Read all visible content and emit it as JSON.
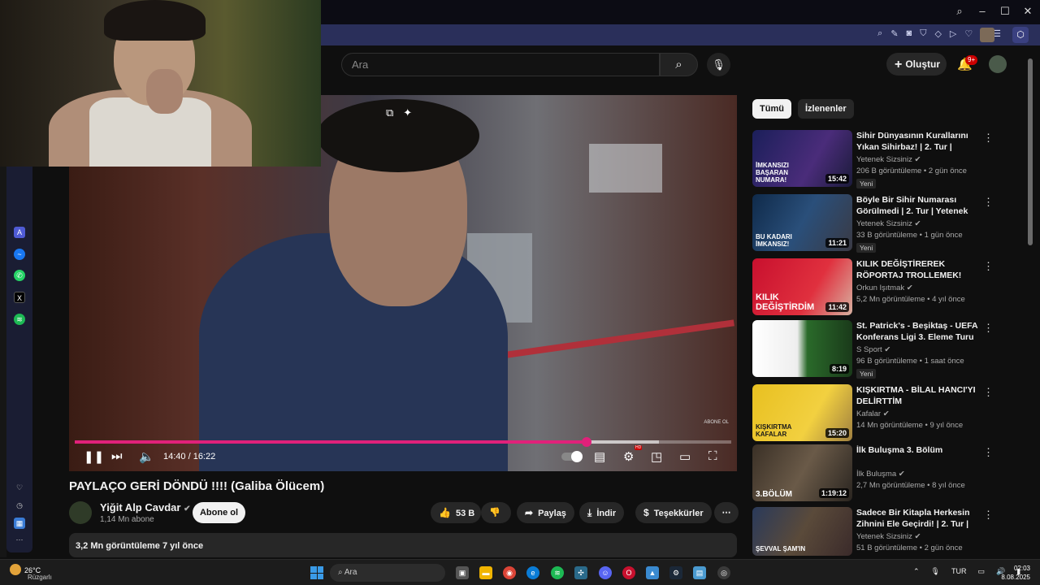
{
  "search": {
    "placeholder": "Ara"
  },
  "header": {
    "create_label": "Oluştur",
    "notification_badge": "9+"
  },
  "player": {
    "time": "14:40 / 16:22",
    "progress_fraction": 0.78,
    "buffer_fraction": 0.89,
    "watermark": "ABONE OL"
  },
  "video": {
    "title": "PAYLAÇO GERİ DÖNDÜ !!!! (Galiba Ölücem)",
    "channel": "Yiğit Alp Cavdar",
    "subscribers": "1,14 Mn abone",
    "subscribe_label": "Abone ol",
    "likes": "53 B",
    "share_label": "Paylaş",
    "download_label": "İndir",
    "thanks_label": "Teşekkürler",
    "description_meta": "3,2 Mn görüntüleme  7 yıl önce"
  },
  "chips": [
    "Tümü",
    "İzlenenler"
  ],
  "recommendations": [
    {
      "title": "Sihir Dünyasının Kurallarını Yıkan Sihirbaz! | 2. Tur | Yeten…",
      "channel": "Yetenek Sizsiniz",
      "meta": "206 B görüntüleme • 2 gün önce",
      "duration": "15:42",
      "badge": "Yeni",
      "thumb_text": "İMKANSIZI BAŞARAN NUMARA!"
    },
    {
      "title": "Böyle Bir Sihir Numarası Görülmedi | 2. Tur | Yetenek …",
      "channel": "Yetenek Sizsiniz",
      "meta": "33 B görüntüleme • 1 gün önce",
      "duration": "11:21",
      "badge": "Yeni",
      "thumb_text": "BU KADARI İMKANSIZ!"
    },
    {
      "title": "KILIK DEĞİŞTİREREK RÖPORTAJ TROLLEMEK!",
      "channel": "Orkun Işıtmak",
      "meta": "5,2 Mn görüntüleme • 4 yıl önce",
      "duration": "11:42",
      "badge": "",
      "thumb_text": "KILIK DEĞİŞTİRDİM"
    },
    {
      "title": "St. Patrick's - Beşiktaş - UEFA Konferans Ligi 3. Eleme Turu İl…",
      "channel": "S Sport",
      "meta": "96 B görüntüleme • 1 saat önce",
      "duration": "8:19",
      "badge": "Yeni",
      "thumb_text": ""
    },
    {
      "title": "KIŞKIRTMA - BİLAL HANCI'YI DELİRTTİM",
      "channel": "Kafalar",
      "meta": "14 Mn görüntüleme • 9 yıl önce",
      "duration": "15:20",
      "badge": "",
      "thumb_text": "KIŞKIRTMA KAFALAR"
    },
    {
      "title": "İlk Buluşma 3. Bölüm",
      "channel": "İlk Buluşma",
      "meta": "2,7 Mn görüntüleme • 8 yıl önce",
      "duration": "1:19:12",
      "badge": "",
      "thumb_text": "3.BÖLÜM"
    },
    {
      "title": "Sadece Bir Kitapla Herkesin Zihnini Ele Geçirdi! | 2. Tur | …",
      "channel": "Yetenek Sizsiniz",
      "meta": "51 B görüntüleme • 2 gün önce",
      "duration": "",
      "badge": "",
      "thumb_text": "ŞEVVAL ŞAM'IN"
    }
  ],
  "taskbar": {
    "weather_temp": "26°C",
    "weather_desc": "Rüzgarlı",
    "search_placeholder": "Ara",
    "language": "TUR",
    "time": "02:03",
    "date": "8.08.2025"
  },
  "colors": {
    "progress": "#e0217a",
    "toolbar": "#2a2f5a",
    "background": "#0f0f0f"
  }
}
